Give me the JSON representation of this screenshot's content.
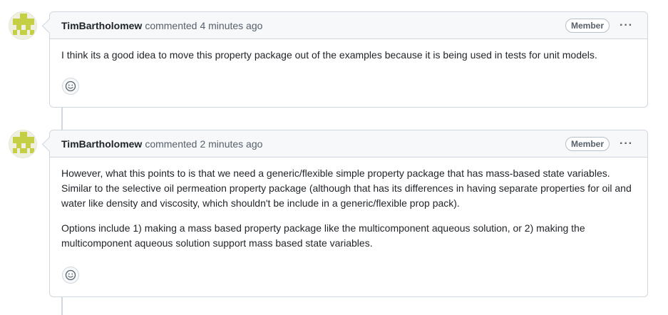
{
  "comments": [
    {
      "author": "TimBartholomew",
      "action": "commented",
      "time": "4 minutes ago",
      "badge": "Member",
      "menu": "···",
      "paragraphs": [
        "I think its a good idea to move this property package out of the examples because it is being used in tests for unit models."
      ]
    },
    {
      "author": "TimBartholomew",
      "action": "commented",
      "time": "2 minutes ago",
      "badge": "Member",
      "menu": "···",
      "paragraphs": [
        "However, what this points to is that we need a generic/flexible simple property package that has mass-based state variables. Similar to the selective oil permeation property package (although that has its differences in having separate properties for oil and water like density and viscosity, which shouldn't be include in a generic/flexible prop pack).",
        "Options include 1) making a mass based property package like the multicomponent aqueous solution, or 2) making the multicomponent aqueous solution support mass based state variables."
      ]
    }
  ],
  "icons": {
    "avatar": "identicon-avatar",
    "reaction": "smiley-icon",
    "menu": "kebab-icon"
  },
  "colors": {
    "identicon": "#c5cf45",
    "border": "#d0d7de",
    "header_bg": "#f6f8fa"
  }
}
